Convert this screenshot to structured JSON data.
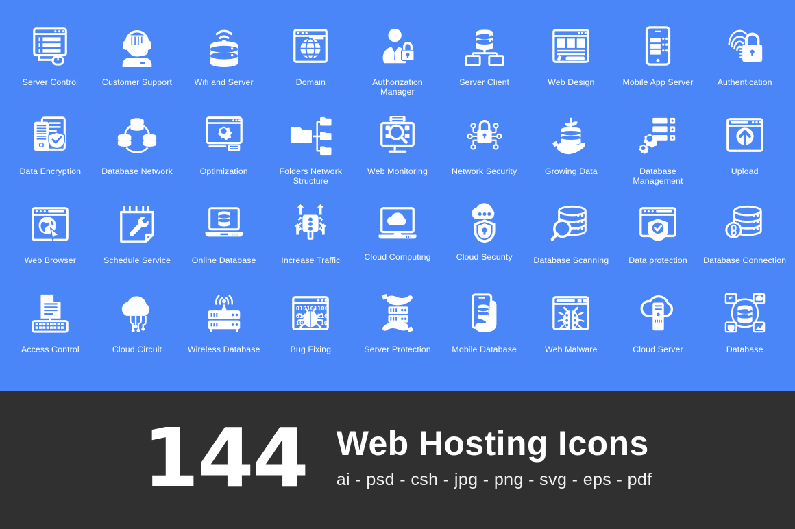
{
  "theme": {
    "background_blue": "#4a86f7",
    "banner_background": "#303030",
    "icon_color": "#ffffff",
    "label_color": "#ffffff"
  },
  "grid": {
    "columns": 9,
    "rows": 4,
    "icons": [
      {
        "icon": "server-control-icon",
        "label": "Server Control"
      },
      {
        "icon": "customer-support-icon",
        "label": "Customer Support"
      },
      {
        "icon": "wifi-and-server-icon",
        "label": "Wifi and Server"
      },
      {
        "icon": "domain-icon",
        "label": "Domain"
      },
      {
        "icon": "authorization-manager-icon",
        "label": "Authorization Manager"
      },
      {
        "icon": "server-client-icon",
        "label": "Server Client"
      },
      {
        "icon": "web-design-icon",
        "label": "Web Design"
      },
      {
        "icon": "mobile-app-server-icon",
        "label": "Mobile App Server"
      },
      {
        "icon": "authentication-icon",
        "label": "Authentication"
      },
      {
        "icon": "data-encryption-icon",
        "label": "Data Encryption"
      },
      {
        "icon": "database-network-icon",
        "label": "Database Network"
      },
      {
        "icon": "optimization-icon",
        "label": "Optimization"
      },
      {
        "icon": "folders-network-structure-icon",
        "label": "Folders Network\nStructure"
      },
      {
        "icon": "web-monitoring-icon",
        "label": "Web Monitoring"
      },
      {
        "icon": "network-security-icon",
        "label": "Network Security"
      },
      {
        "icon": "growing-data-icon",
        "label": "Growing Data"
      },
      {
        "icon": "database-management-icon",
        "label": "Database\nManagement"
      },
      {
        "icon": "upload-icon",
        "label": "Upload"
      },
      {
        "icon": "web-browser-icon",
        "label": "Web Browser"
      },
      {
        "icon": "schedule-service-icon",
        "label": "Schedule Service"
      },
      {
        "icon": "online-database-icon",
        "label": "Online Database"
      },
      {
        "icon": "increase-traffic-icon",
        "label": "Increase Traffic"
      },
      {
        "icon": "cloud-computing-icon",
        "label": "Cloud Computing"
      },
      {
        "icon": "cloud-security-icon",
        "label": "Cloud Security"
      },
      {
        "icon": "database-scanning-icon",
        "label": "Database Scanning"
      },
      {
        "icon": "data-protection-icon",
        "label": "Data protection"
      },
      {
        "icon": "database-connection-icon",
        "label": "Database Connection"
      },
      {
        "icon": "access-control-icon",
        "label": "Access Control"
      },
      {
        "icon": "cloud-circuit-icon",
        "label": "Cloud Circuit"
      },
      {
        "icon": "wireless-database-icon",
        "label": "Wireless Database"
      },
      {
        "icon": "bug-fixing-icon",
        "label": "Bug Fixing"
      },
      {
        "icon": "server-protection-icon",
        "label": "Server Protection"
      },
      {
        "icon": "mobile-database-icon",
        "label": "Mobile Database"
      },
      {
        "icon": "web-malware-icon",
        "label": "Web Malware"
      },
      {
        "icon": "cloud-server-icon",
        "label": "Cloud Server"
      },
      {
        "icon": "database-icon",
        "label": "Database"
      }
    ]
  },
  "banner": {
    "count": "144",
    "title": "Web Hosting Icons",
    "formats": "ai - psd - csh - jpg - png - svg - eps - pdf"
  }
}
